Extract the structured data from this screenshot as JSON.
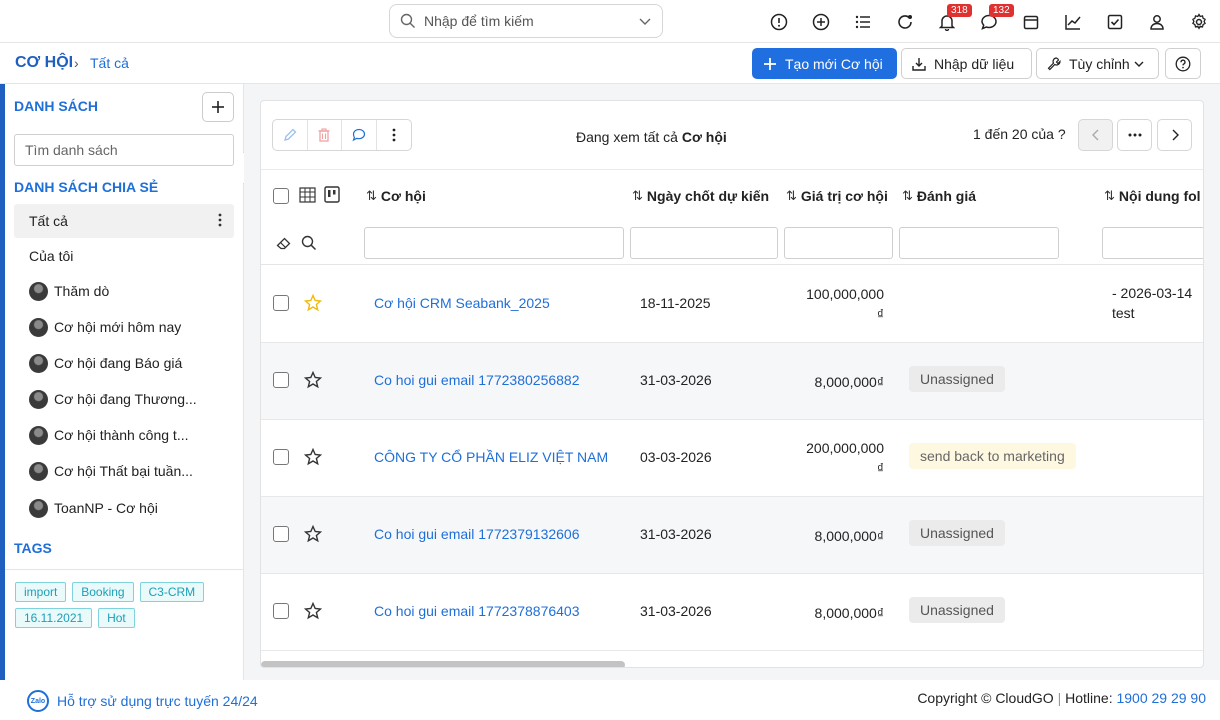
{
  "search": {
    "placeholder": "Nhập để tìm kiếm",
    "value": ""
  },
  "topbar": {
    "icons": [
      "alert-icon",
      "add-circle-icon",
      "list-icon",
      "refresh-icon",
      "bell-icon",
      "chat-icon",
      "calendar-icon",
      "chart-icon",
      "checkbox-icon",
      "user-icon",
      "gear-icon"
    ],
    "bell_badge": "318",
    "chat_badge": "132"
  },
  "breadcrumb": {
    "module": "CƠ HỘI",
    "current": "Tất cả"
  },
  "actions": {
    "create_label": "Tạo mới Cơ hội",
    "import_label": "Nhập dữ liệu",
    "customize_label": "Tùy chỉnh"
  },
  "sidebar": {
    "list_title": "DANH SÁCH",
    "search_placeholder": "Tìm danh sách",
    "shared_title": "DANH SÁCH CHIA SẺ",
    "items": [
      {
        "label": "Tất cả",
        "avatar": false
      },
      {
        "label": "Của tôi",
        "avatar": false
      },
      {
        "label": "Thăm dò",
        "avatar": true
      },
      {
        "label": "Cơ hội mới hôm nay",
        "avatar": true
      },
      {
        "label": "Cơ hội đang Báo giá",
        "avatar": true
      },
      {
        "label": "Cơ hội đang Thương...",
        "avatar": true
      },
      {
        "label": "Cơ hội thành công t...",
        "avatar": true
      },
      {
        "label": "Cơ hội Thất bại tuần...",
        "avatar": true
      },
      {
        "label": "ToanNP - Cơ hội",
        "avatar": true
      }
    ],
    "tags_title": "TAGS",
    "tags": [
      "import",
      "Booking",
      "C3-CRM",
      "16.11.2021",
      "Hot"
    ]
  },
  "listview": {
    "viewing_prefix": "Đang xem tất cả",
    "viewing_module": "Cơ hội",
    "pager": "1 đến 20 của ?",
    "columns": [
      "Cơ hội",
      "Ngày chốt dự kiến",
      "Giá trị cơ hội",
      "Đánh giá",
      "Nội dung fol"
    ],
    "rows": [
      {
        "name": "Cơ hội CRM Seabank_2025",
        "close_date": "18-11-2025",
        "amount": "100,000,000",
        "currency": "₫",
        "rating": "",
        "rating_style": "",
        "followup_1": "- 2026-03-14",
        "followup_2": "test",
        "starred": true
      },
      {
        "name": "Co hoi gui email 1772380256882",
        "close_date": "31-03-2026",
        "amount": "8,000,000₫",
        "currency": "",
        "rating": "Unassigned",
        "rating_style": "gray",
        "followup_1": "",
        "followup_2": "",
        "starred": false
      },
      {
        "name": "CÔNG TY CỔ PHẦN ELIZ VIỆT NAM",
        "close_date": "03-03-2026",
        "amount": "200,000,000",
        "currency": "₫",
        "rating": "send back to marketing",
        "rating_style": "yellow",
        "followup_1": "",
        "followup_2": "",
        "starred": false
      },
      {
        "name": "Co hoi gui email 1772379132606",
        "close_date": "31-03-2026",
        "amount": "8,000,000₫",
        "currency": "",
        "rating": "Unassigned",
        "rating_style": "gray",
        "followup_1": "",
        "followup_2": "",
        "starred": false
      },
      {
        "name": "Co hoi gui email 1772378876403",
        "close_date": "31-03-2026",
        "amount": "8,000,000₫",
        "currency": "",
        "rating": "Unassigned",
        "rating_style": "gray",
        "followup_1": "",
        "followup_2": "",
        "starred": false
      }
    ]
  },
  "footer": {
    "zalo": "Zalo",
    "support": "Hỗ trợ sử dụng trực tuyến 24/24",
    "copyright": "Copyright © CloudGO",
    "hotline_label": "Hotline:",
    "hotline": "1900 29 29 90"
  },
  "colors": {
    "primary": "#1f6fe0",
    "brand": "#1f5fbf",
    "badge": "#e03131",
    "tag": "#1aa0b8"
  }
}
